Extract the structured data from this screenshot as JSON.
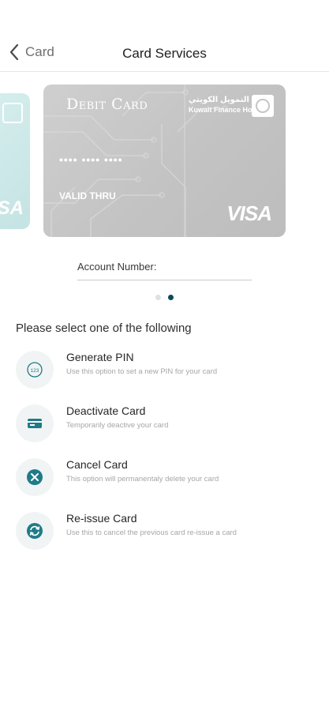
{
  "header": {
    "back_label": "Card",
    "title": "Card Services"
  },
  "card_prev": {
    "brand": "SA"
  },
  "card": {
    "type": "Debit Card",
    "masked_number": "•••• •••• ••••",
    "valid_thru": "VALID THRU",
    "network": "VISA",
    "bank_name_ar": "بيت التمويل الكويتي",
    "bank_name_en": "Kuwait Finance House"
  },
  "account": {
    "label": "Account Number:"
  },
  "pager": {
    "count": 2,
    "active_index": 1
  },
  "prompt": "Please select one of the following",
  "options": [
    {
      "title": "Generate PIN",
      "subtitle": "Use this option to set a new PIN for your card",
      "icon": "pin-icon"
    },
    {
      "title": "Deactivate Card",
      "subtitle": "Temporarily deactive your card",
      "icon": "card-icon"
    },
    {
      "title": "Cancel Card",
      "subtitle": "This option will permanentaly delete your card",
      "icon": "cancel-icon"
    },
    {
      "title": "Re-issue Card",
      "subtitle": "Use this to cancel the previous card re-issue a card",
      "icon": "reissue-icon"
    }
  ],
  "colors": {
    "accent": "#1f7b88",
    "dark_accent": "#0c4a58",
    "card_gray": "#c3c3c3",
    "card_prev": "#cfe9e9"
  }
}
